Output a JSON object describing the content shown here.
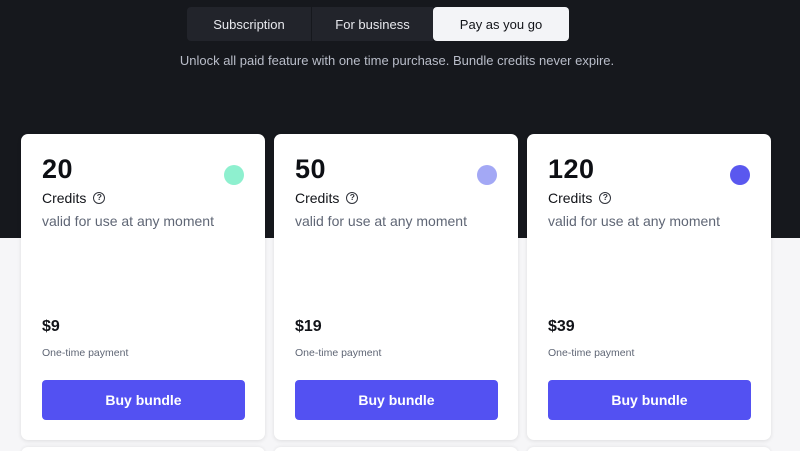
{
  "tabs": [
    {
      "label": "Subscription",
      "active": false
    },
    {
      "label": "For business",
      "active": false
    },
    {
      "label": "Pay as you go",
      "active": true
    }
  ],
  "subtitle": "Unlock all paid feature with one time purchase. Bundle credits never expire.",
  "cards": [
    {
      "amount": "20",
      "credits_label": "Credits",
      "help_icon": "?",
      "validity": "valid for use at any moment",
      "price": "$9",
      "payment_note": "One-time payment",
      "button_label": "Buy bundle",
      "dot_color": "#8ef0cf",
      "dot_icon": "circle-indicator"
    },
    {
      "amount": "50",
      "credits_label": "Credits",
      "help_icon": "?",
      "validity": "valid for use at any moment",
      "price": "$19",
      "payment_note": "One-time payment",
      "button_label": "Buy bundle",
      "dot_color": "#a3a8f5",
      "dot_icon": "circle-indicator"
    },
    {
      "amount": "120",
      "credits_label": "Credits",
      "help_icon": "?",
      "validity": "valid for use at any moment",
      "price": "$39",
      "payment_note": "One-time payment",
      "button_label": "Buy bundle",
      "dot_color": "#5a58ef",
      "dot_icon": "circle-indicator"
    }
  ],
  "colors": {
    "header_background": "#16181d",
    "accent": "#5351f2",
    "active_tab": "#f3f4f7"
  }
}
